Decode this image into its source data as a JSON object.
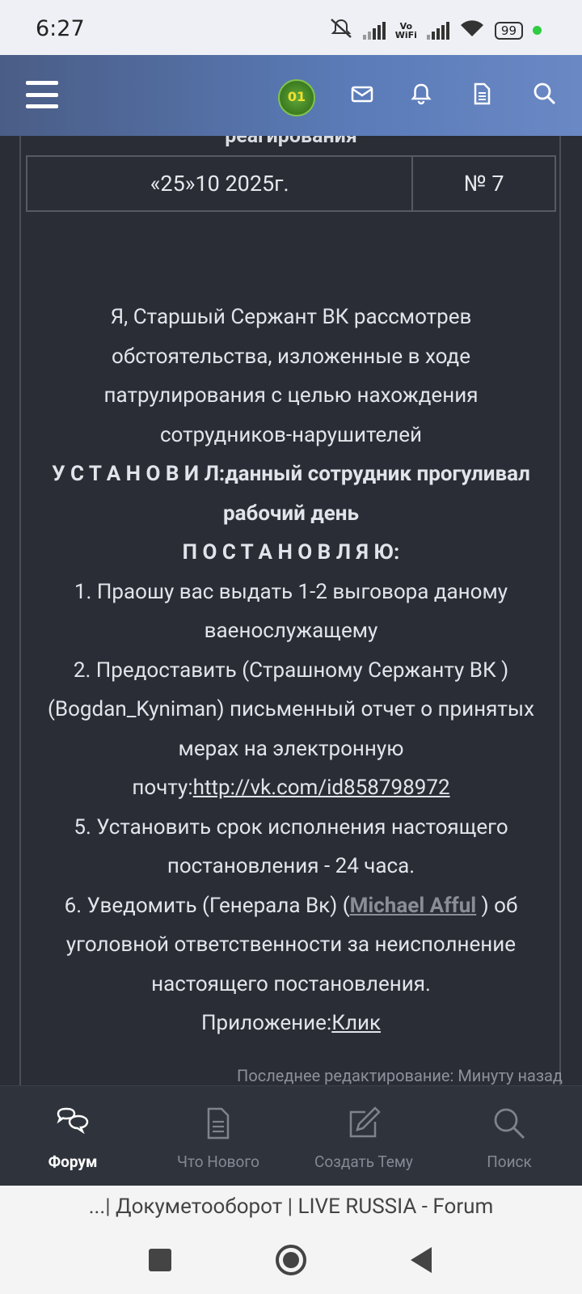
{
  "status_bar": {
    "time": "6:27",
    "wifi_label_top": "Vo",
    "wifi_label_bottom": "WiFi",
    "battery": "99"
  },
  "header": {
    "avatar_text": "01"
  },
  "document": {
    "cut_title": "реагирования",
    "date": "«25»10 2025г.",
    "number": "№ 7",
    "para1": [
      "Я, Старшый Сержант ВК рассмотрев",
      "обстоятельства, изложенные в ходе",
      "патрулирования с целью нахождения",
      "сотрудников-нарушителей"
    ],
    "established_label": "У С Т А Н О В И Л:",
    "established_text_1": "данный сотрудник прогуливал",
    "established_text_2": "рабочий день",
    "resolve_label": "П О С Т А Н О В Л Я Ю:",
    "item1": [
      "1. Праошу вас выдать 1-2 выговора даному",
      "ваенослужащему"
    ],
    "item2": [
      "2. Предоставить (Страшному Сержанту ВК )",
      "(Bogdan_Kyniman) письменный отчет о принятых",
      "мерах на электронную"
    ],
    "email_prefix": "почту:",
    "email_link": "http://vk.com/id858798972",
    "item5": [
      "5. Установить срок исполнения настоящего",
      "постановления - 24 часа."
    ],
    "item6_prefix": "6. Уведомить (Генерала Вк) (",
    "item6_mention": "Michael Afful",
    "item6_suffix": " ) об",
    "item6_rest": [
      "уголовной ответственности за неисполнение",
      "настоящего постановления."
    ],
    "attachment_prefix": "Приложение:",
    "attachment_link": "Клик"
  },
  "edited_note": "Последнее редактирование: Минуту назад",
  "tabs": [
    {
      "label": "Форум",
      "icon": "forum-icon",
      "active": true
    },
    {
      "label": "Что Нового",
      "icon": "document-icon",
      "active": false
    },
    {
      "label": "Создать Тему",
      "icon": "edit-icon",
      "active": false
    },
    {
      "label": "Поиск",
      "icon": "search-icon",
      "active": false
    }
  ],
  "browser_title": "...| Докуметооборот | LIVE RUSSIA - Forum",
  "colors": {
    "accent": "#5a7bb8",
    "background": "#2a2d35",
    "online_dot": "#2ecc40"
  }
}
